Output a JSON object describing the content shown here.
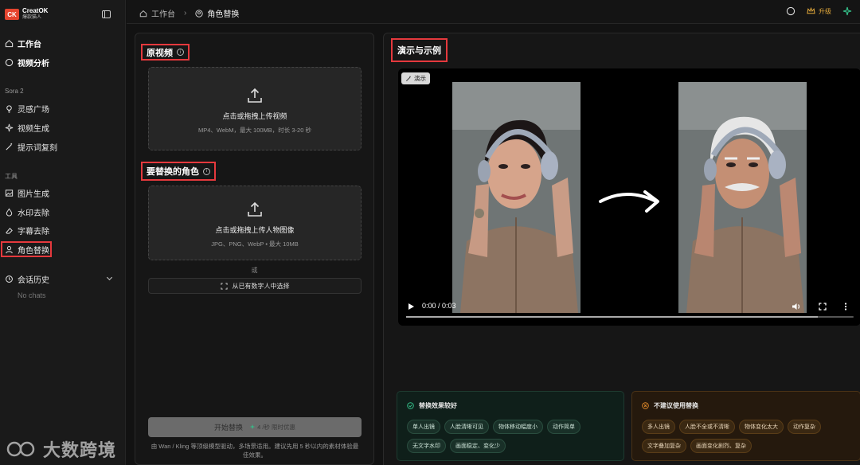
{
  "brand": {
    "name": "CreatOK",
    "sub": "爆款猫人",
    "logo": "CK"
  },
  "sidebar": {
    "main_items": [
      {
        "label": "工作台",
        "icon": "home-icon"
      },
      {
        "label": "视频分析",
        "icon": "chat-bubble-icon"
      }
    ],
    "section_sora": "Sora 2",
    "sora_items": [
      {
        "label": "灵感广场",
        "icon": "bulb-icon"
      },
      {
        "label": "视频生成",
        "icon": "sparkle-icon"
      },
      {
        "label": "提示词复刻",
        "icon": "wand-icon"
      }
    ],
    "section_tools": "工具",
    "tool_items": [
      {
        "label": "图片生成",
        "icon": "image-icon"
      },
      {
        "label": "水印去除",
        "icon": "droplet-icon"
      },
      {
        "label": "字幕去除",
        "icon": "eraser-icon"
      },
      {
        "label": "角色替换",
        "icon": "user-icon"
      }
    ],
    "history_label": "会话历史",
    "no_chats": "No chats"
  },
  "breadcrumb": {
    "home": "工作台",
    "current": "角色替换"
  },
  "topbar": {
    "upgrade_label": "升级"
  },
  "left": {
    "video_title": "原视频",
    "video_upload_text": "点击或拖拽上传视频",
    "video_upload_hint": "MP4、WebM，最大 100MB，时长 3-20 秒",
    "role_title": "要替换的角色",
    "role_upload_text": "点击或拖拽上传人物图像",
    "role_upload_hint": "JPG、PNG、WebP • 最大 10MB",
    "or": "或",
    "pick_label": "从已有数字人中选择",
    "start_label": "开始替换",
    "start_cost": "4 /秒 限时优惠",
    "note": "由 Wan / Kling 等顶级模型驱动，多场景适用。建议先用 5 秒以内的素材体验最佳效果。"
  },
  "right": {
    "title": "演示与示例",
    "demo_tag": "演示",
    "time": "0:00 / 0:03",
    "progress": 0.92,
    "good_title": "替换效果较好",
    "good_chips": [
      "单人出镜",
      "人脸清晰可见",
      "物体移动幅度小",
      "动作简单",
      "无文字水印",
      "画面稳定、变化少"
    ],
    "bad_title": "不建议使用替换",
    "bad_chips": [
      "多人出镜",
      "人脸不全或不清晰",
      "物体变化太大",
      "动作复杂",
      "文字叠加复杂",
      "画面变化剧烈、复杂"
    ]
  },
  "watermark": {
    "text": "大数跨境"
  },
  "colors": {
    "accent_red": "#e5393d",
    "upgrade_gold": "#e2a93b",
    "good_green": "#34c28a",
    "bad_orange": "#e28b2b"
  }
}
